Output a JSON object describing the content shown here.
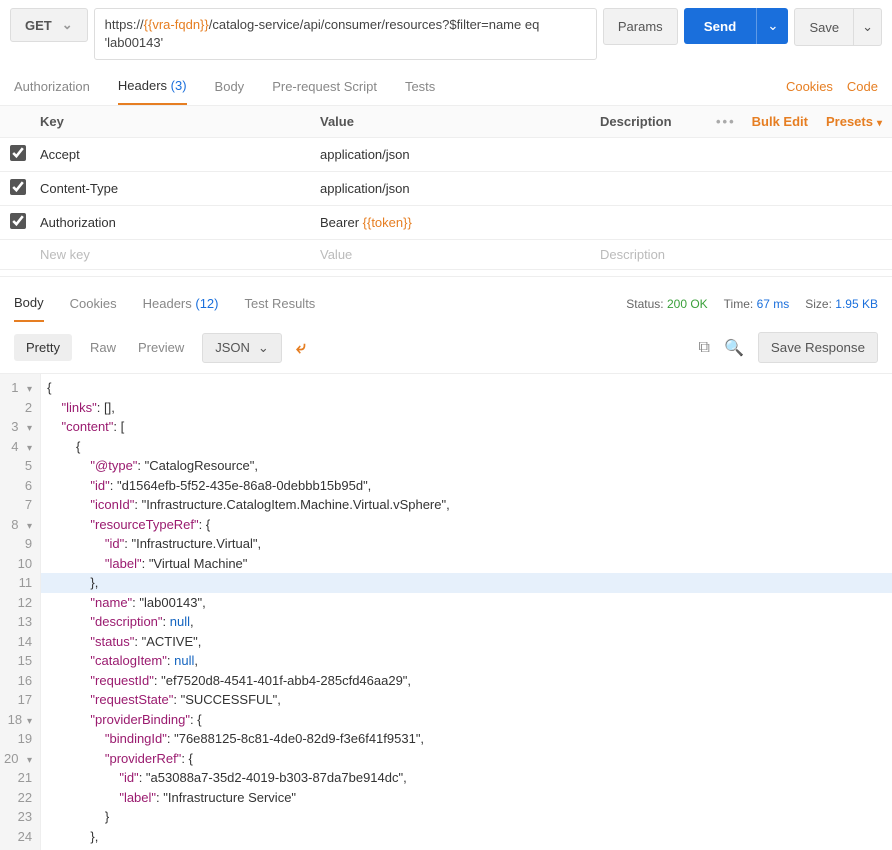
{
  "request": {
    "method": "GET",
    "url_prefix": "https://",
    "url_var1": "{{vra-fqdn}}",
    "url_rest": "/catalog-service/api/consumer/resources?$filter=name eq 'lab00143'",
    "params_btn": "Params",
    "send_btn": "Send",
    "save_btn": "Save"
  },
  "req_tabs": {
    "authorization": "Authorization",
    "headers": "Headers",
    "headers_count": "(3)",
    "body": "Body",
    "prerequest": "Pre-request Script",
    "tests": "Tests",
    "cookies_link": "Cookies",
    "code_link": "Code"
  },
  "hdr_table": {
    "key_h": "Key",
    "value_h": "Value",
    "desc_h": "Description",
    "bulk_edit": "Bulk Edit",
    "presets": "Presets",
    "rows": [
      {
        "key": "Accept",
        "value": "application/json"
      },
      {
        "key": "Content-Type",
        "value": "application/json"
      },
      {
        "key": "Authorization",
        "value_prefix": "Bearer ",
        "value_var": "{{token}}"
      }
    ],
    "new_key": "New key",
    "new_value": "Value",
    "new_desc": "Description"
  },
  "resp_tabs": {
    "body": "Body",
    "cookies": "Cookies",
    "headers": "Headers",
    "headers_count": "(12)",
    "test_results": "Test Results",
    "status_label": "Status:",
    "status_value": "200 OK",
    "time_label": "Time:",
    "time_value": "67 ms",
    "size_label": "Size:",
    "size_value": "1.95 KB"
  },
  "view_bar": {
    "pretty": "Pretty",
    "raw": "Raw",
    "preview": "Preview",
    "format": "JSON",
    "save_response": "Save Response"
  },
  "code": {
    "lines": [
      "{",
      "    \"links\": [],",
      "    \"content\": [",
      "        {",
      "            \"@type\": \"CatalogResource\",",
      "            \"id\": \"d1564efb-5f52-435e-86a8-0debbb15b95d\",",
      "            \"iconId\": \"Infrastructure.CatalogItem.Machine.Virtual.vSphere\",",
      "            \"resourceTypeRef\": {",
      "                \"id\": \"Infrastructure.Virtual\",",
      "                \"label\": \"Virtual Machine\"",
      "            },",
      "            \"name\": \"lab00143\",",
      "            \"description\": null,",
      "            \"status\": \"ACTIVE\",",
      "            \"catalogItem\": null,",
      "            \"requestId\": \"ef7520d8-4541-401f-abb4-285cfd46aa29\",",
      "            \"requestState\": \"SUCCESSFUL\",",
      "            \"providerBinding\": {",
      "                \"bindingId\": \"76e88125-8c81-4de0-82d9-f3e6f41f9531\",",
      "                \"providerRef\": {",
      "                    \"id\": \"a53088a7-35d2-4019-b303-87da7be914dc\",",
      "                    \"label\": \"Infrastructure Service\"",
      "                }",
      "            },"
    ]
  },
  "chart_data": {
    "type": "table",
    "title": "Response JSON content",
    "data": {
      "links": [],
      "content": [
        {
          "@type": "CatalogResource",
          "id": "d1564efb-5f52-435e-86a8-0debbb15b95d",
          "iconId": "Infrastructure.CatalogItem.Machine.Virtual.vSphere",
          "resourceTypeRef": {
            "id": "Infrastructure.Virtual",
            "label": "Virtual Machine"
          },
          "name": "lab00143",
          "description": null,
          "status": "ACTIVE",
          "catalogItem": null,
          "requestId": "ef7520d8-4541-401f-abb4-285cfd46aa29",
          "requestState": "SUCCESSFUL",
          "providerBinding": {
            "bindingId": "76e88125-8c81-4de0-82d9-f3e6f41f9531",
            "providerRef": {
              "id": "a53088a7-35d2-4019-b303-87da7be914dc",
              "label": "Infrastructure Service"
            }
          }
        }
      ]
    }
  }
}
